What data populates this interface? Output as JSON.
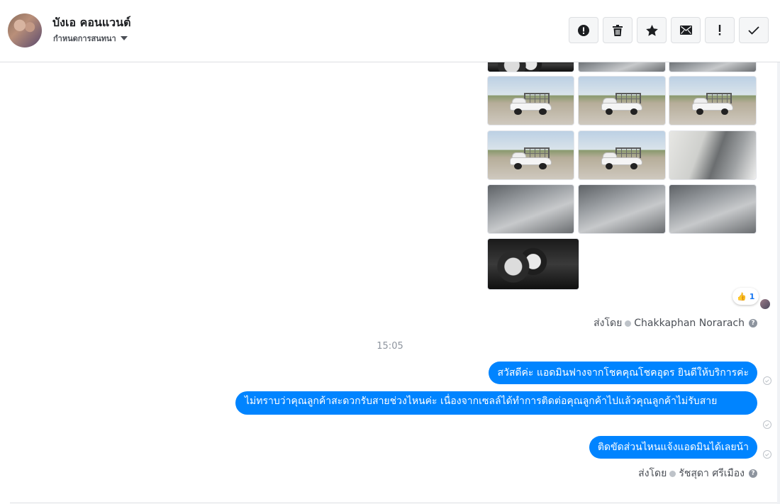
{
  "header": {
    "contact_name": "บังเอ คอนแวนต์",
    "subtitle": "กำหนดการสนทนา",
    "actions": [
      {
        "name": "mark-spam-button",
        "icon": "alert-circle-icon"
      },
      {
        "name": "delete-button",
        "icon": "trash-icon"
      },
      {
        "name": "star-button",
        "icon": "star-icon"
      },
      {
        "name": "mark-unread-button",
        "icon": "envelope-icon"
      },
      {
        "name": "follow-up-button",
        "icon": "exclamation-icon"
      },
      {
        "name": "mark-done-button",
        "icon": "checkmark-icon"
      }
    ]
  },
  "thread": {
    "reaction": {
      "emoji": "👍",
      "count": "1"
    },
    "sent_by_1": {
      "prefix": "ส่งโดย",
      "sender": "Chakkaphan Norarach"
    },
    "timestamp": "15:05",
    "messages": [
      {
        "text": "สวัสดีค่ะ แอดมินฟางจากโชคคุณโชคอุดร ยินดีให้บริการค่ะ"
      },
      {
        "text": "ไม่ทราบว่าคุณลูกค้าสะดวกรับสายช่วงไหนค่ะ   เนื่องจากเซลล์ได้ทำการติดต่อคุณลูกค้าไปแล้วคุณลูกค้าไม่รับสาย"
      },
      {
        "text": "ติดขัดส่วนไหนแจ้งแอดมินได้เลยน้า"
      }
    ],
    "sent_by_2": {
      "prefix": "ส่งโดย",
      "sender": "รัชสุดา ศรีเมือง"
    },
    "help_glyph": "?"
  },
  "colors": {
    "bubble": "#0084ff",
    "header_border": "#dddfe2",
    "muted_text": "#8d949e"
  }
}
